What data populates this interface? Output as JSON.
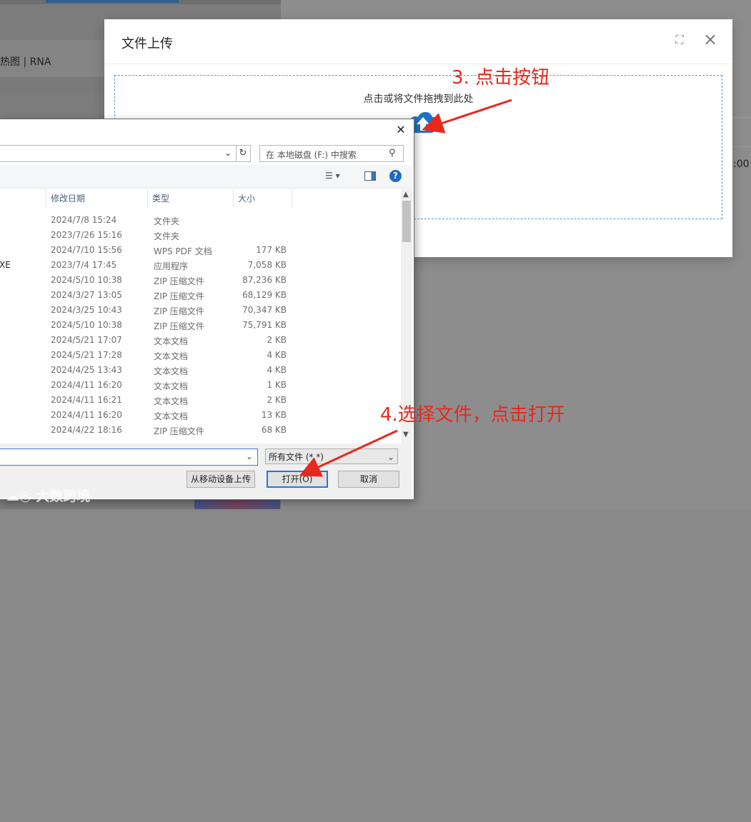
{
  "background": {
    "partial_title": "热图 | RNA",
    "right_edge_text": ":00"
  },
  "upload_modal": {
    "title": "文件上传",
    "expand_icon": "expand-icon",
    "close_icon": "close-icon",
    "dropzone_text": "点击或将文件拖拽到此处",
    "upload_icon": "cloud-upload-icon",
    "accent_color": "#1a73c8"
  },
  "annotations": {
    "step3": "3. 点击按钮",
    "step4": "4.选择文件，点击打开",
    "color": "#e8281e"
  },
  "file_dialog": {
    "search_placeholder": "在 本地磁盘 (F:) 中搜索",
    "columns": {
      "date": "修改日期",
      "type": "类型",
      "size": "大小"
    },
    "files": [
      {
        "name": "",
        "date": "2024/7/8 15:24",
        "type": "文件夹",
        "size": ""
      },
      {
        "name": "",
        "date": "2023/7/26 15:16",
        "type": "文件夹",
        "size": ""
      },
      {
        "name": "",
        "date": "2024/7/10 15:56",
        "type": "WPS PDF 文档",
        "size": "177 KB"
      },
      {
        "name": "XE",
        "date": "2023/7/4 17:45",
        "type": "应用程序",
        "size": "7,058 KB"
      },
      {
        "name": "",
        "date": "2024/5/10 10:38",
        "type": "ZIP 压缩文件",
        "size": "87,236 KB"
      },
      {
        "name": "",
        "date": "2024/3/27 13:05",
        "type": "ZIP 压缩文件",
        "size": "68,129 KB"
      },
      {
        "name": "",
        "date": "2024/3/25 10:43",
        "type": "ZIP 压缩文件",
        "size": "70,347 KB"
      },
      {
        "name": "",
        "date": "2024/5/10 10:38",
        "type": "ZIP 压缩文件",
        "size": "75,791 KB"
      },
      {
        "name": "",
        "date": "2024/5/21 17:07",
        "type": "文本文档",
        "size": "2 KB"
      },
      {
        "name": "",
        "date": "2024/5/21 17:28",
        "type": "文本文档",
        "size": "4 KB"
      },
      {
        "name": "",
        "date": "2024/4/25 13:43",
        "type": "文本文档",
        "size": "4 KB"
      },
      {
        "name": "",
        "date": "2024/4/11 16:20",
        "type": "文本文档",
        "size": "1 KB"
      },
      {
        "name": "",
        "date": "2024/4/11 16:21",
        "type": "文本文档",
        "size": "2 KB"
      },
      {
        "name": "",
        "date": "2024/4/11 16:20",
        "type": "文本文档",
        "size": "13 KB"
      },
      {
        "name": "",
        "date": "2024/4/22 18:16",
        "type": "ZIP 压缩文件",
        "size": "68 KB"
      }
    ],
    "filename_value": "",
    "filter_value": "所有文件 (*.*)",
    "buttons": {
      "mobile": "从移动设备上传",
      "open": "打开(O)",
      "cancel": "取消"
    }
  },
  "watermark": "大数跨境"
}
